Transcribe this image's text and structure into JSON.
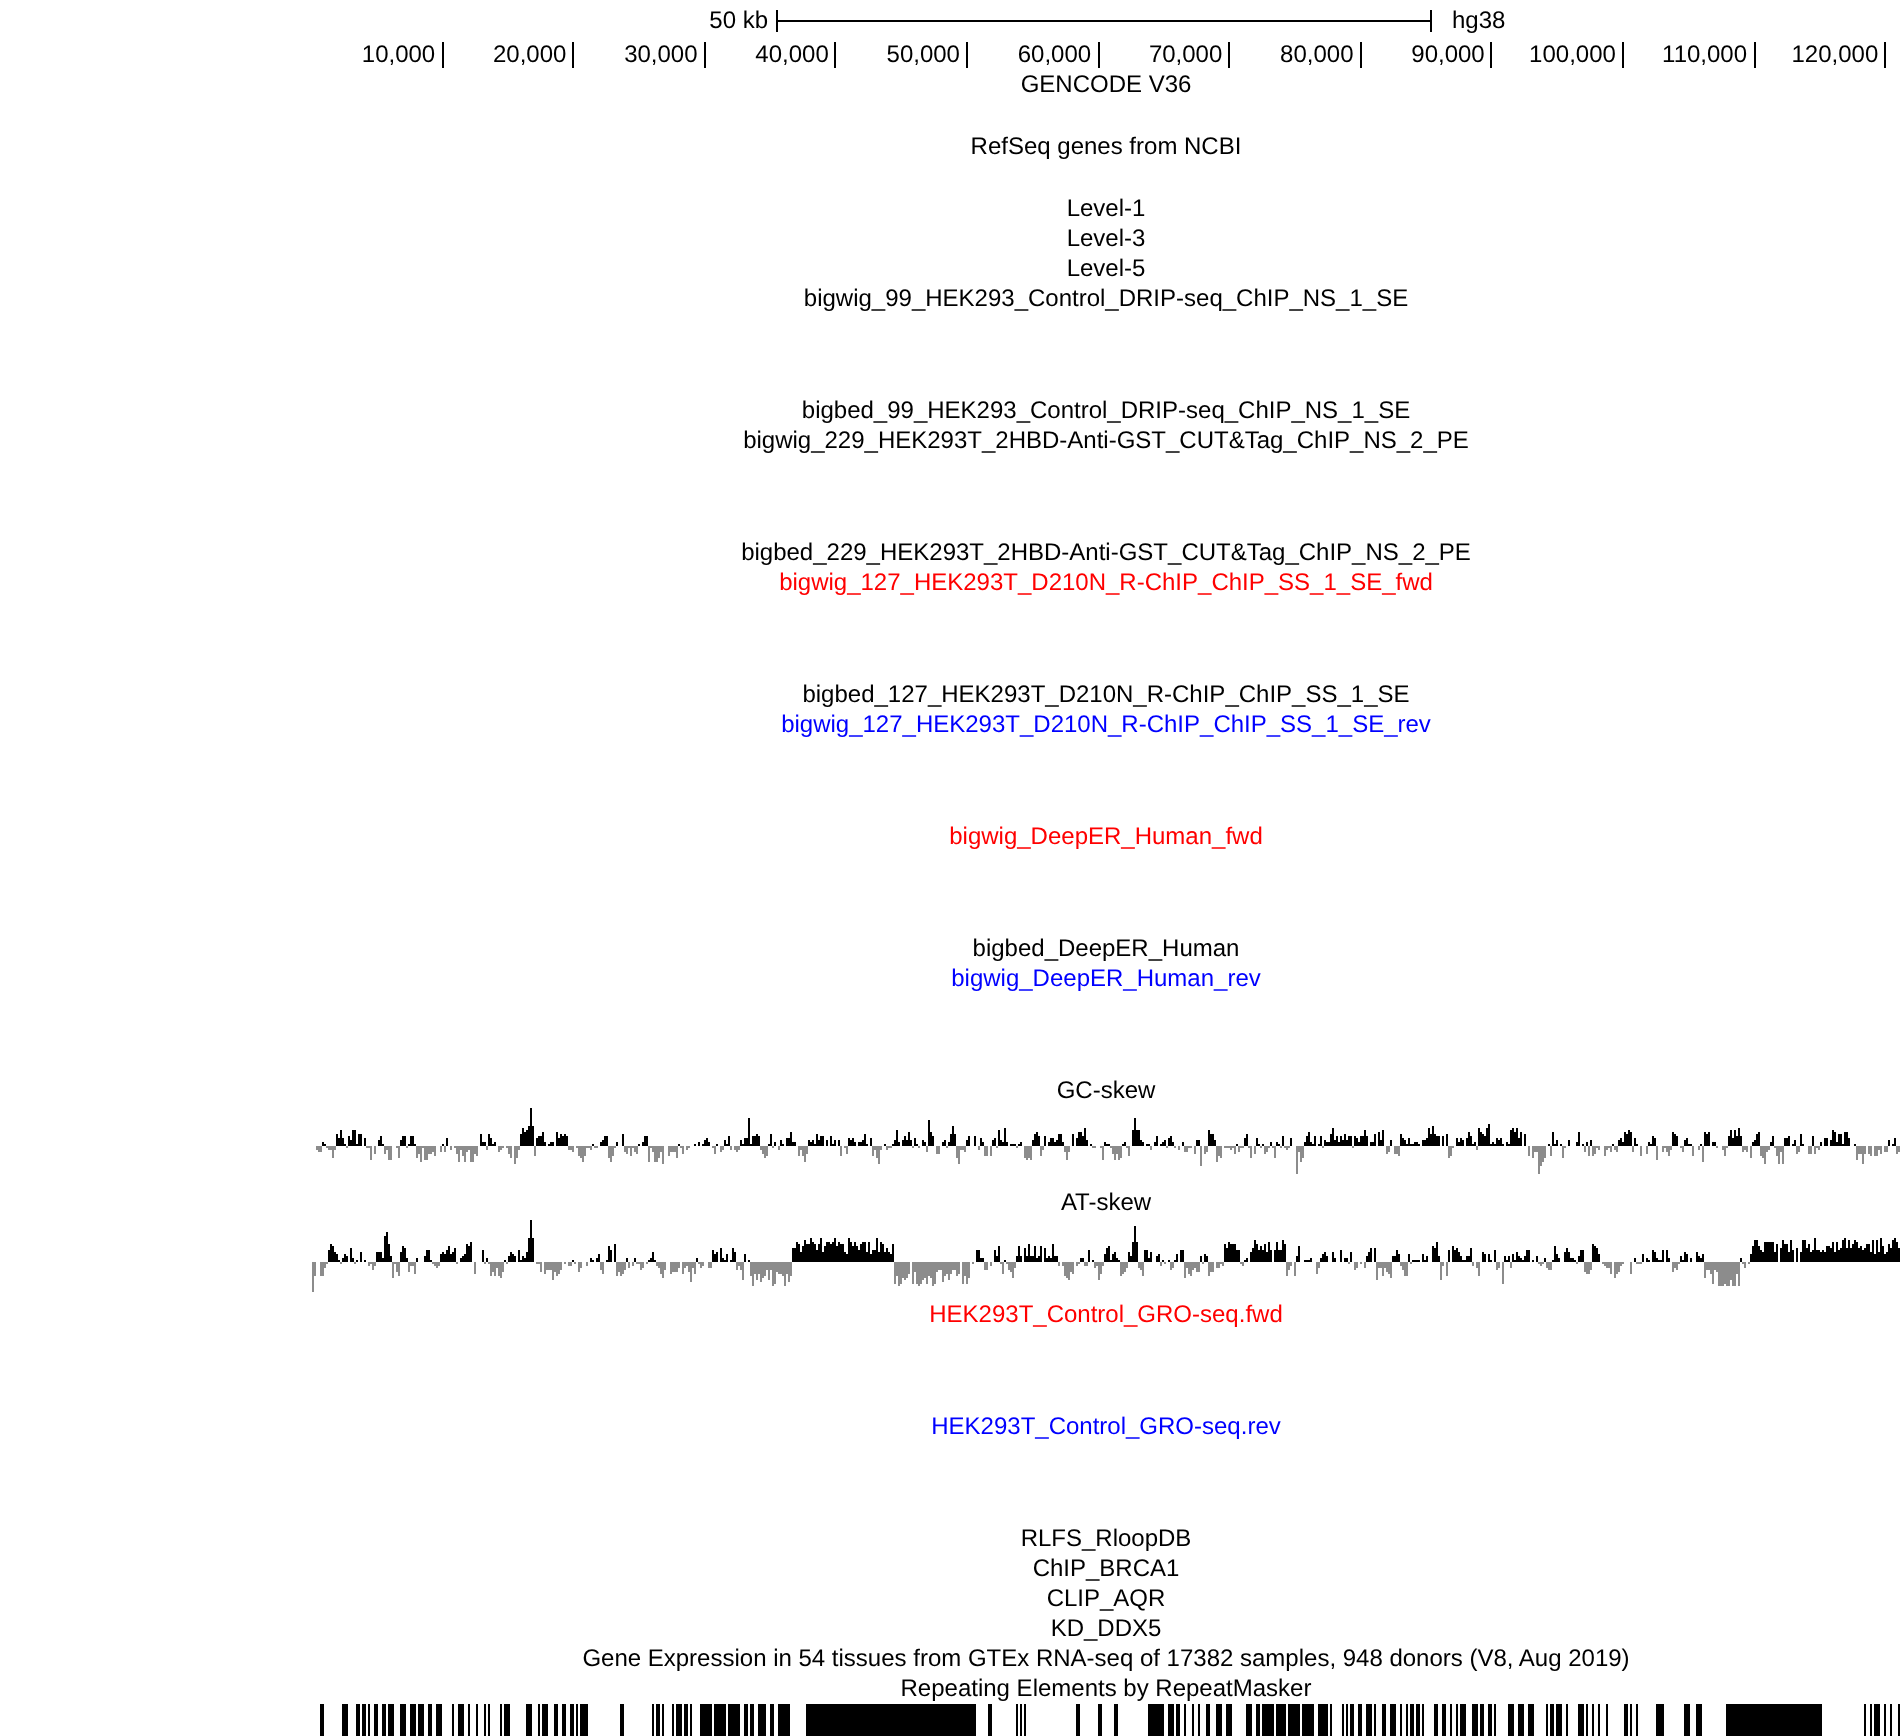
{
  "ruler": {
    "scale": "50 kb",
    "assembly": "hg38",
    "positions": [
      "10,000",
      "20,000",
      "30,000",
      "40,000",
      "50,000",
      "60,000",
      "70,000",
      "80,000",
      "90,000",
      "100,000",
      "110,000",
      "120,000"
    ]
  },
  "tracks": [
    {
      "kind": "gene",
      "label": "GENCODE V36",
      "color": "#000000"
    },
    {
      "kind": "gene",
      "label": "RefSeq genes from NCBI",
      "color": "#000000"
    },
    {
      "kind": "bed",
      "label": "Level-1",
      "color": "#000000"
    },
    {
      "kind": "bed",
      "label": "Level-3",
      "color": "#000000"
    },
    {
      "kind": "bed",
      "label": "Level-5",
      "color": "#000000"
    },
    {
      "kind": "signal",
      "label": "bigwig_99_HEK293_Control_DRIP-seq_ChIP_NS_1_SE",
      "color": "#000000"
    },
    {
      "kind": "bed",
      "label": "bigbed_99_HEK293_Control_DRIP-seq_ChIP_NS_1_SE",
      "color": "#000000"
    },
    {
      "kind": "signal",
      "label": "bigwig_229_HEK293T_2HBD-Anti-GST_CUT&Tag_ChIP_NS_2_PE",
      "color": "#000000"
    },
    {
      "kind": "bed",
      "label": "bigbed_229_HEK293T_2HBD-Anti-GST_CUT&Tag_ChIP_NS_2_PE",
      "color": "#000000"
    },
    {
      "kind": "signal",
      "label": "bigwig_127_HEK293T_D210N_R-ChIP_ChIP_SS_1_SE_fwd",
      "color": "#ff0000"
    },
    {
      "kind": "bed",
      "label": "bigbed_127_HEK293T_D210N_R-ChIP_ChIP_SS_1_SE",
      "color": "#000000"
    },
    {
      "kind": "signal",
      "label": "bigwig_127_HEK293T_D210N_R-ChIP_ChIP_SS_1_SE_rev",
      "color": "#0000ff"
    },
    {
      "kind": "signal",
      "label": "bigwig_DeepER_Human_fwd",
      "color": "#ff0000"
    },
    {
      "kind": "bed",
      "label": "bigbed_DeepER_Human",
      "color": "#000000"
    },
    {
      "kind": "signal",
      "label": "bigwig_DeepER_Human_rev",
      "color": "#0000ff"
    },
    {
      "kind": "skew",
      "label": "GC-skew",
      "color": "#000000"
    },
    {
      "kind": "skew",
      "label": "AT-skew",
      "color": "#000000"
    },
    {
      "kind": "signal",
      "label": "HEK293T_Control_GRO-seq.fwd",
      "color": "#ff0000"
    },
    {
      "kind": "signal",
      "label": "HEK293T_Control_GRO-seq.rev",
      "color": "#0000ff"
    },
    {
      "kind": "bed",
      "label": "RLFS_RloopDB",
      "color": "#000000"
    },
    {
      "kind": "bed",
      "label": "ChIP_BRCA1",
      "color": "#000000"
    },
    {
      "kind": "bed",
      "label": "CLIP_AQR",
      "color": "#000000"
    },
    {
      "kind": "bed",
      "label": "KD_DDX5",
      "color": "#000000"
    },
    {
      "kind": "bed",
      "label": "Gene Expression in 54 tissues from GTEx RNA-seq of 17382 samples, 948 donors (V8, Aug 2019)",
      "color": "#000000"
    },
    {
      "kind": "repeat",
      "label": "Repeating Elements by RepeatMasker",
      "color": "#000000"
    }
  ]
}
